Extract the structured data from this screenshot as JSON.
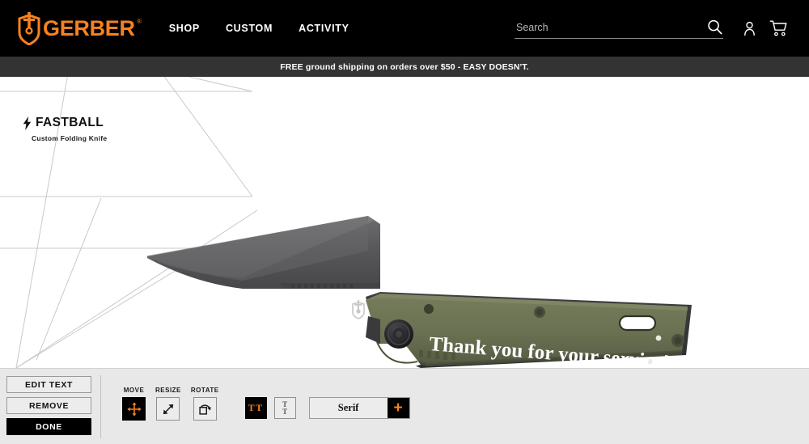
{
  "header": {
    "brand": "GERBER",
    "brand_tm": "®",
    "logo_icon": "gerber-shield-sword-logo",
    "nav": [
      {
        "label": "SHOP"
      },
      {
        "label": "CUSTOM"
      },
      {
        "label": "ACTIVITY"
      }
    ],
    "search": {
      "placeholder": "Search",
      "value": "",
      "icon": "search-icon"
    },
    "account_icon": "user-account-icon",
    "cart_icon": "shopping-cart-icon",
    "brand_color": "#F5821F",
    "background_color": "#000000"
  },
  "promo": {
    "text": "FREE ground shipping on orders over $50 - EASY DOESN'T.",
    "background_color": "#333333"
  },
  "product": {
    "name": "FASTBALL",
    "subtitle": "Custom Folding Knife",
    "bolt_icon": "lightning-bolt-icon",
    "handle_color": "#6b7252",
    "blade_color": "#5a5a5c",
    "engraving": {
      "text": "Thank you for your service!",
      "font": "Serif",
      "color": "#ffffff"
    }
  },
  "toolbar": {
    "background_color": "#e8e8e8",
    "actions": [
      {
        "label": "EDIT TEXT",
        "style": "outline"
      },
      {
        "label": "REMOVE",
        "style": "outline"
      },
      {
        "label": "DONE",
        "style": "primary"
      }
    ],
    "tools": [
      {
        "label": "MOVE",
        "icon": "move-arrows-icon",
        "active": true
      },
      {
        "label": "RESIZE",
        "icon": "resize-diagonal-arrows-icon",
        "active": false
      },
      {
        "label": "ROTATE",
        "icon": "rotate-square-arrow-icon",
        "active": false
      }
    ],
    "text_orientation": {
      "horizontal": {
        "icon": "text-horizontal-icon",
        "glyph": "TT",
        "active": true
      },
      "vertical": {
        "icon": "text-vertical-icon",
        "glyph_top": "T",
        "glyph_bottom": "T",
        "active": false
      }
    },
    "font_select": {
      "value": "Serif",
      "add_label": "+",
      "add_icon": "plus-icon"
    },
    "accent_color": "#F5821F"
  }
}
